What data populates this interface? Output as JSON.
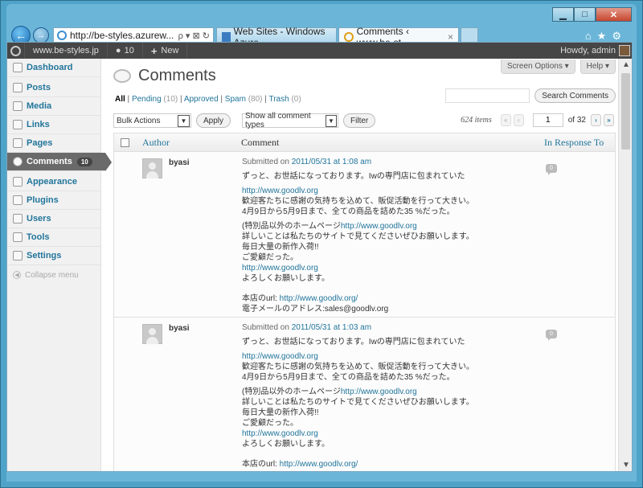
{
  "browser": {
    "address": "http://be-styles.azurew...",
    "address_tools": "ρ ▾ ⊠ ↻",
    "tabs": [
      {
        "label": "Web Sites - Windows Azure"
      },
      {
        "label": "Comments ‹ www.be-st..."
      }
    ],
    "tab_close": "×",
    "window_buttons": {
      "minimize": "▁",
      "maximize": "□",
      "close": "✕"
    },
    "right_tools": "⌂★⚙"
  },
  "adminbar": {
    "site": "www.be-styles.jp",
    "comments_count": "10",
    "new_label": "New",
    "howdy": "Howdy, admin"
  },
  "sidebar": {
    "items": [
      {
        "label": "Dashboard"
      },
      {
        "label": "Posts"
      },
      {
        "label": "Media"
      },
      {
        "label": "Links"
      },
      {
        "label": "Pages"
      },
      {
        "label": "Comments",
        "badge": "10"
      },
      {
        "label": "Appearance"
      },
      {
        "label": "Plugins"
      },
      {
        "label": "Users"
      },
      {
        "label": "Tools"
      },
      {
        "label": "Settings"
      }
    ],
    "collapse": "Collapse menu"
  },
  "main": {
    "screen_options": "Screen Options ▾",
    "help": "Help ▾",
    "title": "Comments",
    "filters": {
      "all": "All",
      "pending": "Pending",
      "pending_count": "(10)",
      "approved": "Approved",
      "spam": "Spam",
      "spam_count": "(80)",
      "trash": "Trash",
      "trash_count": "(0)"
    },
    "search_button": "Search Comments",
    "bulk_actions": "Bulk Actions",
    "apply": "Apply",
    "comment_types": "Show all comment types",
    "filter": "Filter",
    "items_count": "624 items",
    "page_current": "1",
    "page_total": "of 32",
    "columns": {
      "author": "Author",
      "comment": "Comment",
      "in_response_to": "In Response To"
    }
  },
  "comments": [
    {
      "author": "byasi",
      "submitted_prefix": "Submitted on",
      "submitted_date": "2011/05/31 at 1:08 am",
      "line1": "ずっと、お世話になっております。Iwの専門店に包まれていた",
      "url1": "http://www.goodlv.org",
      "line2": "歓迎客たちに感謝の気持ちを込めて、販促活動を行って大きい。",
      "line3": "4月9日から5月9日まで、全ての商品を詰めた35 %だった。",
      "line4_prefix": "(特別品以外のホームページ",
      "line4_url": "http://www.goodlv.org",
      "line5": "詳しいことは私たちのサイトで見てくださいぜひお願いします。",
      "line6": "毎日大量の新作入荷!!",
      "line7": "ご愛顧だった。",
      "url2": "http://www.goodlv.org",
      "line8": "よろしくお願いします。",
      "store_prefix": "本店のurl: ",
      "store_url": "http://www.goodlv.org/",
      "email": "電子メールのアドレス:sales@goodlv.org",
      "response_count": "0"
    },
    {
      "author": "byasi",
      "submitted_prefix": "Submitted on",
      "submitted_date": "2011/05/31 at 1:03 am",
      "line1": "ずっと、お世話になっております。Iwの専門店に包まれていた",
      "url1": "http://www.goodlv.org",
      "line2": "歓迎客たちに感謝の気持ちを込めて、販促活動を行って大きい。",
      "line3": "4月9日から5月9日まで、全ての商品を詰めた35 %だった。",
      "line4_prefix": "(特別品以外のホームページ",
      "line4_url": "http://www.goodlv.org",
      "line5": "詳しいことは私たちのサイトで見てくださいぜひお願いします。",
      "line6": "毎日大量の新作入荷!!",
      "line7": "ご愛顧だった。",
      "url2": "http://www.goodlv.org",
      "line8": "よろしくお願いします。",
      "store_prefix": "本店のurl: ",
      "store_url": "http://www.goodlv.org/",
      "response_count": "0"
    }
  ]
}
